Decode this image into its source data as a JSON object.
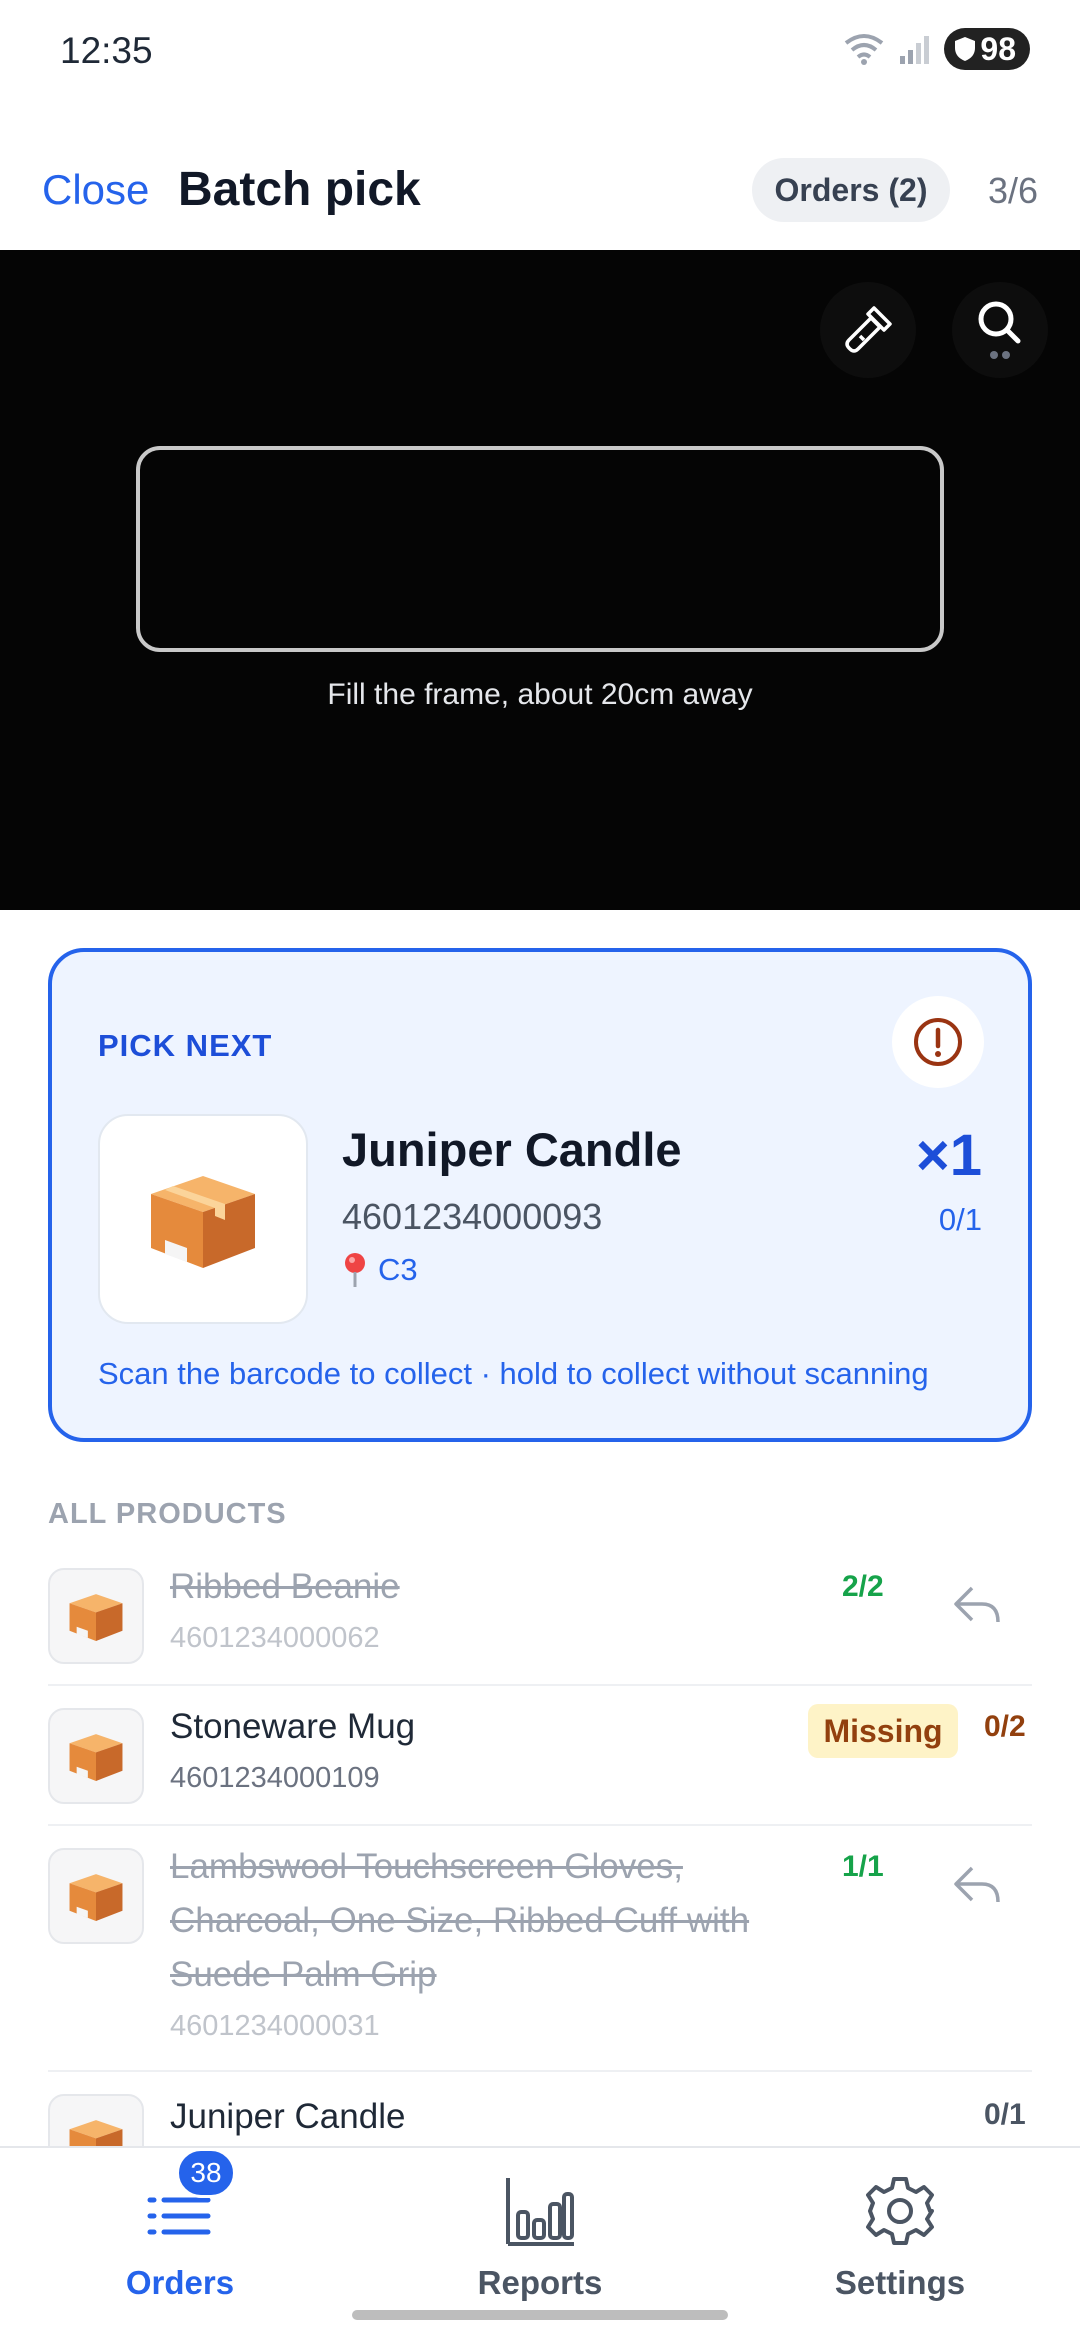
{
  "status_bar": {
    "time": "12:35",
    "battery": "98"
  },
  "header": {
    "close_label": "Close",
    "title": "Batch pick",
    "orders_label": "Orders (2)",
    "progress": "3/6"
  },
  "camera": {
    "hint": "Fill the frame, about 20cm away",
    "flashlight_icon": "flashlight-icon",
    "search_icon": "search-icon"
  },
  "pick_next": {
    "label": "PICK NEXT",
    "name": "Juniper Candle",
    "barcode": "4601234000093",
    "location": "C3",
    "quantity": "×1",
    "progress": "0/1",
    "instruction": "Scan the barcode to collect · hold to collect without scanning"
  },
  "all_products": {
    "label": "ALL PRODUCTS",
    "items": [
      {
        "name": "Ribbed Beanie",
        "barcode": "4601234000062",
        "count": "2/2",
        "state": "done"
      },
      {
        "name": "Stoneware Mug",
        "barcode": "4601234000109",
        "count": "0/2",
        "state": "missing",
        "badge": "Missing"
      },
      {
        "name_lines": [
          "Lambswool Touchscreen Gloves,",
          "Charcoal, One Size, Ribbed Cuff with",
          "Suede Palm Grip"
        ],
        "barcode": "4601234000031",
        "count": "1/1",
        "state": "done"
      },
      {
        "name": "Juniper Candle",
        "count": "0/1",
        "state": "pending"
      }
    ]
  },
  "nav": {
    "orders": "Orders",
    "orders_badge": "38",
    "reports": "Reports",
    "settings": "Settings"
  },
  "colors": {
    "accent": "#2563eb",
    "success": "#16a34a",
    "warning_bg": "#fef3c7",
    "warning_text": "#92400e"
  }
}
